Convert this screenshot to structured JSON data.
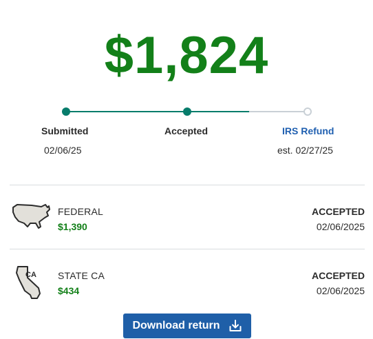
{
  "refund": {
    "amount": "$1,824"
  },
  "tracker": {
    "steps": [
      {
        "label": "Submitted",
        "date": "02/06/25",
        "state": "done"
      },
      {
        "label": "Accepted",
        "date": "",
        "state": "done"
      },
      {
        "label": "IRS Refund",
        "date": "est. 02/27/25",
        "state": "pending"
      }
    ],
    "progress_fraction": 0.75
  },
  "returns": [
    {
      "name": "FEDERAL",
      "amount": "$1,390",
      "status": "ACCEPTED",
      "date": "02/06/2025",
      "icon": "usa-map-icon"
    },
    {
      "name": "STATE CA",
      "amount": "$434",
      "status": "ACCEPTED",
      "date": "02/06/2025",
      "icon": "california-map-icon",
      "icon_label": "CA"
    }
  ],
  "actions": {
    "download_label": "Download return",
    "download_icon": "download-icon"
  },
  "colors": {
    "refund_green": "#138019",
    "track_done": "#077c6b",
    "track_todo": "#c9d0d6",
    "link_blue": "#1f5fb0",
    "button_blue": "#1f5fa8"
  }
}
